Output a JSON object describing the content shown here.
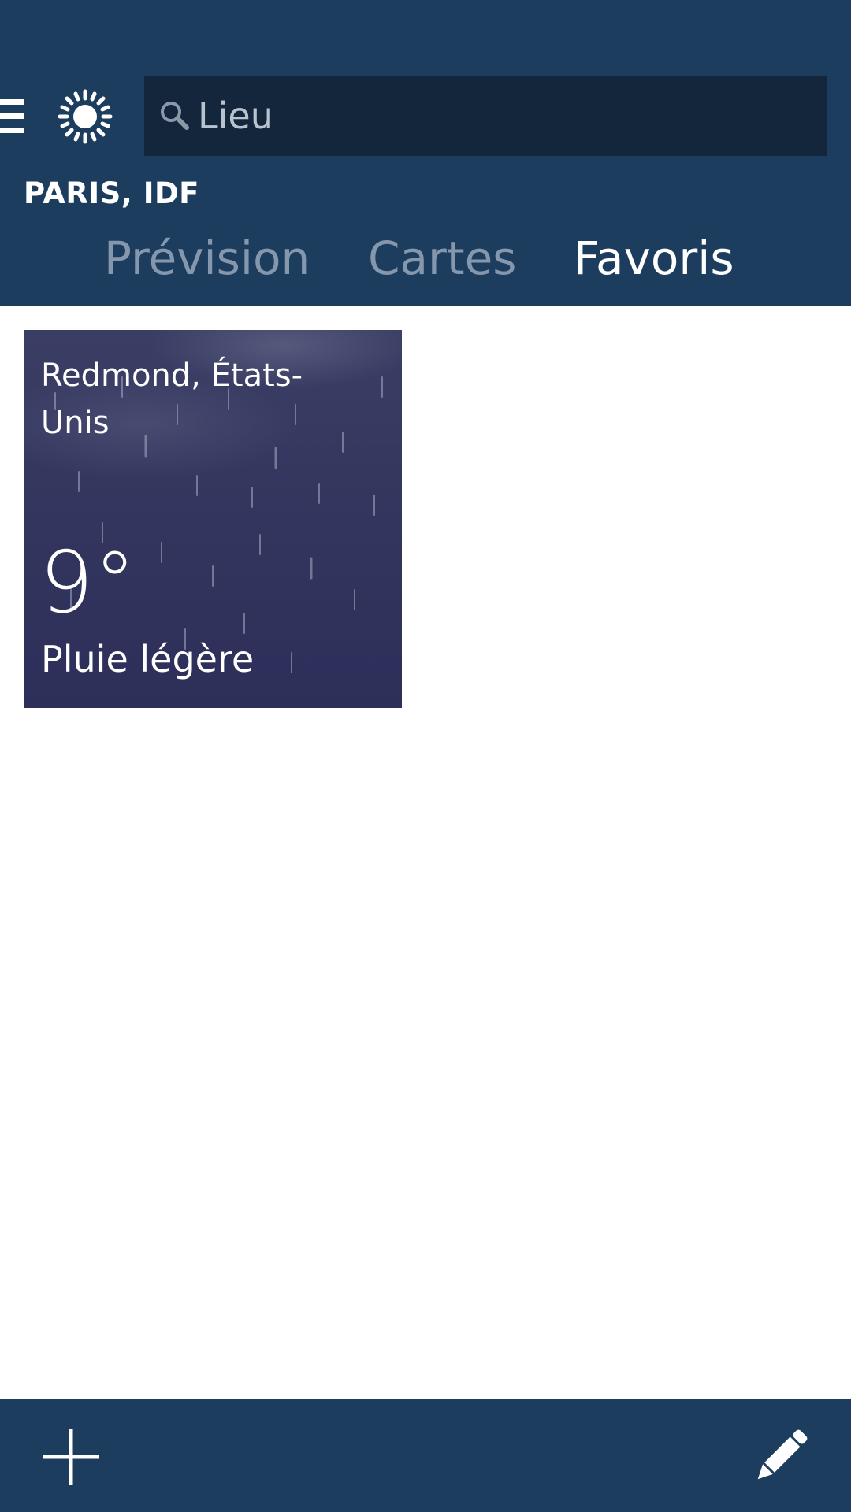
{
  "header": {
    "location": "PARIS, IDF",
    "search": {
      "placeholder": "Lieu",
      "value": ""
    },
    "icons": {
      "menu": "hamburger-menu-icon",
      "weather": "sun-icon",
      "search": "search-icon"
    },
    "tabs": [
      {
        "label": "Prévision",
        "active": false
      },
      {
        "label": "Cartes",
        "active": false
      },
      {
        "label": "Favoris",
        "active": true
      }
    ]
  },
  "favorites": [
    {
      "city": "Redmond, États-Unis",
      "temperature": "9°",
      "condition": "Pluie légère"
    }
  ],
  "bottom_bar": {
    "icons": {
      "add": "plus-icon",
      "edit": "pencil-icon"
    }
  },
  "colors": {
    "header_bg": "#1d3d5f",
    "search_bg": "#13263b",
    "tab_inactive": "#8597ac",
    "tab_active": "#ffffff",
    "tile_bg": "#33365e"
  }
}
